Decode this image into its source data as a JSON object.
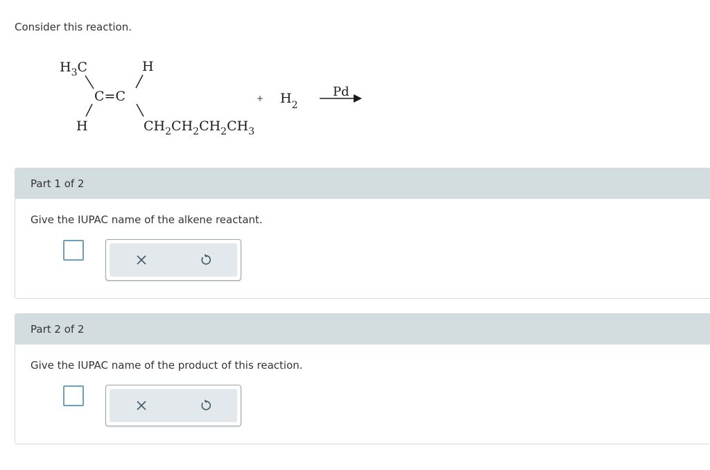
{
  "intro_text": "Consider this reaction.",
  "reaction": {
    "alkene": {
      "top_left": "H3C",
      "top_right": "H",
      "center": "C=C",
      "bottom_left": "H",
      "chain": "CH2CH2CH2CH3"
    },
    "plus": "+",
    "reagent": "H2",
    "catalyst": "Pd"
  },
  "parts": [
    {
      "header": "Part 1 of 2",
      "question": "Give the IUPAC name of the alkene reactant.",
      "answer": ""
    },
    {
      "header": "Part 2 of 2",
      "question": "Give the IUPAC name of the product of this reaction.",
      "answer": ""
    }
  ],
  "icons": {
    "clear": "close-icon",
    "undo": "undo-icon"
  },
  "colors": {
    "header_bg": "#d3dcdf",
    "answer_border": "#6a9fb5",
    "tool_bg": "#e2e8eb",
    "icon": "#3d5a66"
  }
}
